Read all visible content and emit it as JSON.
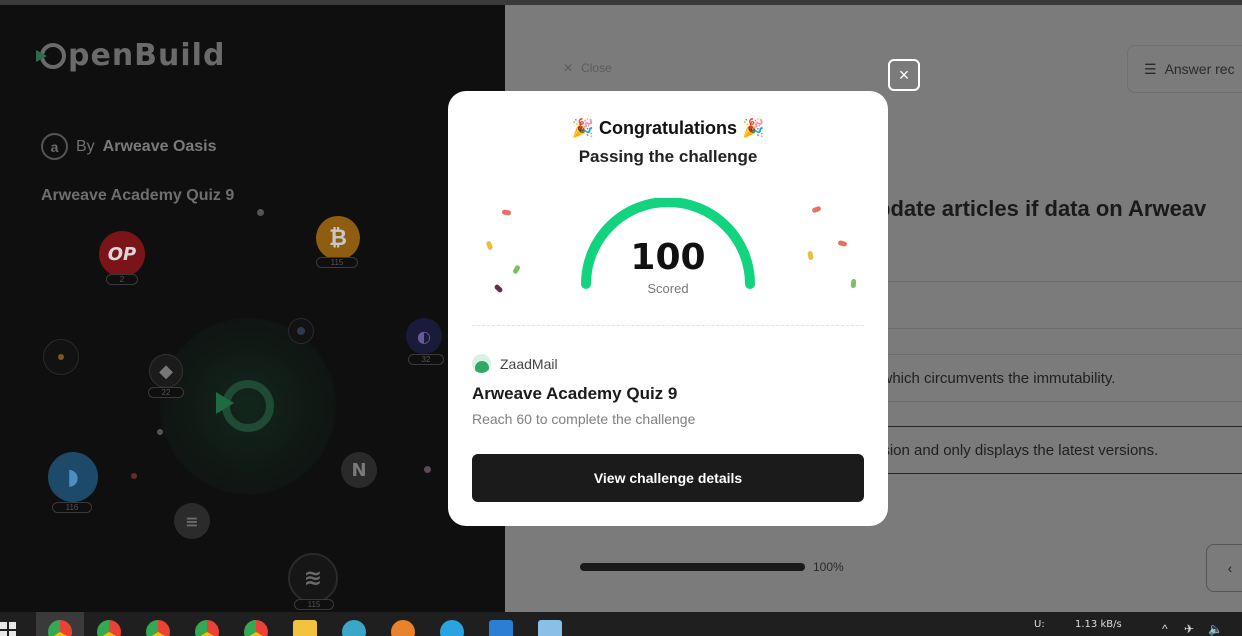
{
  "left": {
    "logo_text": "penBuild",
    "by_prefix": "By",
    "by_name": "Arweave Oasis",
    "quiz_title": "Arweave Academy Quiz 9",
    "badges": {
      "op": "2",
      "btc": "115",
      "eth": "22",
      "sui": "116",
      "sol": "32",
      "bottom": "115"
    },
    "coin_labels": {
      "op": "OP",
      "btc": "₿",
      "near": "N"
    }
  },
  "right": {
    "close_label": "Close",
    "answer_label": "Answer rec",
    "question_text": "pdate articles if data on Arweav",
    "options": [
      "",
      "e which circumvents the immutability.",
      "ersion and only displays the latest versions."
    ],
    "progress_value": 1.0,
    "progress_label": "100%"
  },
  "modal": {
    "close_glyph": "×",
    "party_emoji": "🎉",
    "heading": "Congratulations",
    "subheading": "Passing the challenge",
    "score": "100",
    "score_fraction": 1.0,
    "score_label": "Scored",
    "creator_name": "ZaadMail",
    "quiz_title": "Arweave Academy Quiz 9",
    "quiz_requirement": "Reach 60 to complete the challenge",
    "cta_label": "View challenge details",
    "gauge_color": "#12d47f"
  },
  "taskbar": {
    "net_up": "U:",
    "net_rate": "1.13 kB/s"
  }
}
